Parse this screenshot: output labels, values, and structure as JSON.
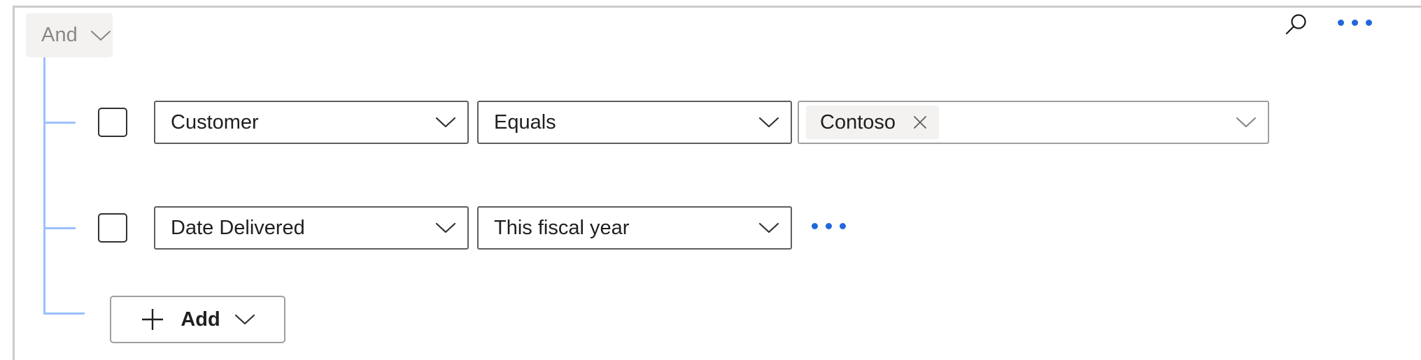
{
  "panel": {
    "group_operator": {
      "label": "And",
      "chevron_icon": "chevron-down-icon",
      "background_color": "#f3f2f1",
      "text_color": "#8a8886"
    },
    "connector_color": "#9cc0fa"
  },
  "conditions": [
    {
      "checkbox_checked": false,
      "field": {
        "value": "Customer",
        "chevron_icon": "chevron-down-icon"
      },
      "operator": {
        "value": "Equals",
        "chevron_icon": "chevron-down-icon"
      },
      "value_field": {
        "tokens": [
          {
            "label": "Contoso",
            "remove_icon": "close-icon"
          }
        ],
        "chevron_icon": "chevron-down-icon",
        "placeholder": ""
      },
      "search_icon": "search-icon",
      "overflow_icon": "more-options-icon",
      "overflow_color": "#2266dd"
    },
    {
      "checkbox_checked": false,
      "field": {
        "value": "Date Delivered",
        "chevron_icon": "chevron-down-icon"
      },
      "operator": {
        "value": "This fiscal year",
        "chevron_icon": "chevron-down-icon"
      },
      "overflow_icon": "more-options-icon",
      "overflow_color": "#2266dd"
    }
  ],
  "add_button": {
    "label": "Add",
    "plus_icon": "plus-icon",
    "chevron_icon": "chevron-down-icon"
  }
}
